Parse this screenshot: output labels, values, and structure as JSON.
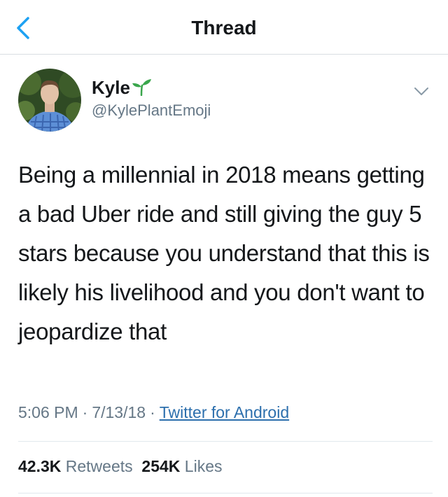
{
  "nav": {
    "title": "Thread",
    "back_icon": "chevron-left-icon"
  },
  "author": {
    "name": "Kyle",
    "name_emoji_icon": "seedling-icon",
    "handle": "@KylePlantEmoji",
    "avatar_icon": "avatar-photo"
  },
  "tweet": {
    "text": "Being a millennial in 2018 means getting a bad Uber ride and still giving the guy 5 stars because you understand that this is likely his livelihood and you don't want to jeopardize that",
    "time": "5:06 PM",
    "date": "7/13/18",
    "sep": "·",
    "source": "Twitter for Android",
    "menu_icon": "chevron-down-icon"
  },
  "stats": {
    "retweets_count": "42.3K",
    "retweets_label": "Retweets",
    "likes_count": "254K",
    "likes_label": "Likes"
  },
  "colors": {
    "text": "#14171a",
    "secondary": "#657786",
    "link": "#2c6fad",
    "accent": "#1da1f2",
    "sprout": "#3aa64c"
  }
}
